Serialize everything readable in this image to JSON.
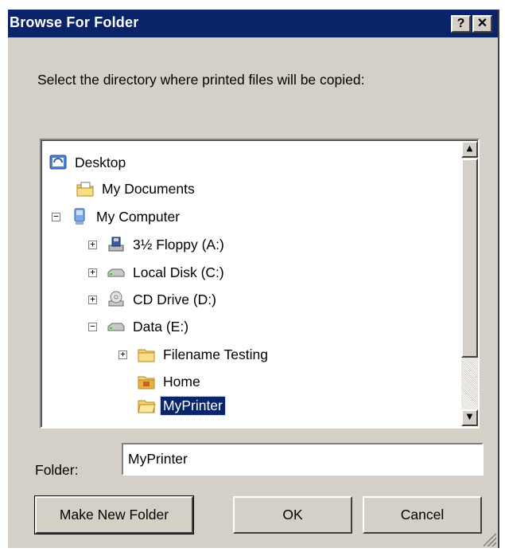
{
  "window": {
    "title": "Browse For Folder",
    "help_label": "?",
    "close_label": "✕"
  },
  "instruction": "Select the directory where printed files will be copied:",
  "tree": {
    "items": [
      {
        "label": "Desktop",
        "icon": "desktop-icon"
      },
      {
        "label": "My Documents",
        "icon": "my-documents-icon"
      },
      {
        "label": "My Computer",
        "icon": "my-computer-icon",
        "expander": "−"
      },
      {
        "label": "3½ Floppy (A:)",
        "icon": "floppy-drive-icon",
        "expander": "+"
      },
      {
        "label": "Local Disk (C:)",
        "icon": "hard-disk-icon",
        "expander": "+"
      },
      {
        "label": "CD Drive (D:)",
        "icon": "cd-drive-icon",
        "expander": "+"
      },
      {
        "label": "Data (E:)",
        "icon": "hard-disk-icon",
        "expander": "−"
      },
      {
        "label": "Filename Testing",
        "icon": "folder-icon",
        "expander": "+"
      },
      {
        "label": "Home",
        "icon": "folder-icon"
      },
      {
        "label": "MyPrinter",
        "icon": "open-folder-icon",
        "selected": true
      }
    ],
    "scroll_up": "▲",
    "scroll_down": "▼"
  },
  "folder": {
    "label": "Folder:",
    "value": "MyPrinter"
  },
  "buttons": {
    "make_new_folder": "Make New Folder",
    "ok": "OK",
    "cancel": "Cancel"
  },
  "colors": {
    "titlebar": "#0a246a",
    "dialog_face": "#d4d0c8",
    "selection": "#0a246a",
    "folder_yellow": "#f5d36b"
  }
}
